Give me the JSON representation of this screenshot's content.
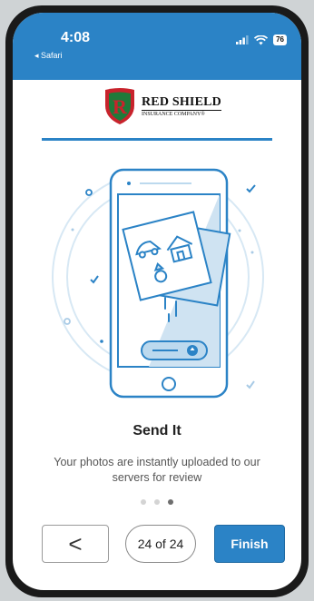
{
  "status_bar": {
    "time": "4:08",
    "back_label": "◂ Safari",
    "battery": "76"
  },
  "logo": {
    "title": "RED SHIELD",
    "subtitle": "INSURANCE COMPANY®",
    "letter": "R"
  },
  "slide": {
    "title": "Send It",
    "description": "Your photos are instantly uploaded to our servers for review"
  },
  "pagination": {
    "total_dots": 3,
    "active_index": 2
  },
  "nav": {
    "back_label": "<",
    "counter": "24 of 24",
    "finish_label": "Finish"
  },
  "colors": {
    "accent": "#2b83c6",
    "brand_red": "#c8232c",
    "brand_green": "#1f7a3a"
  }
}
